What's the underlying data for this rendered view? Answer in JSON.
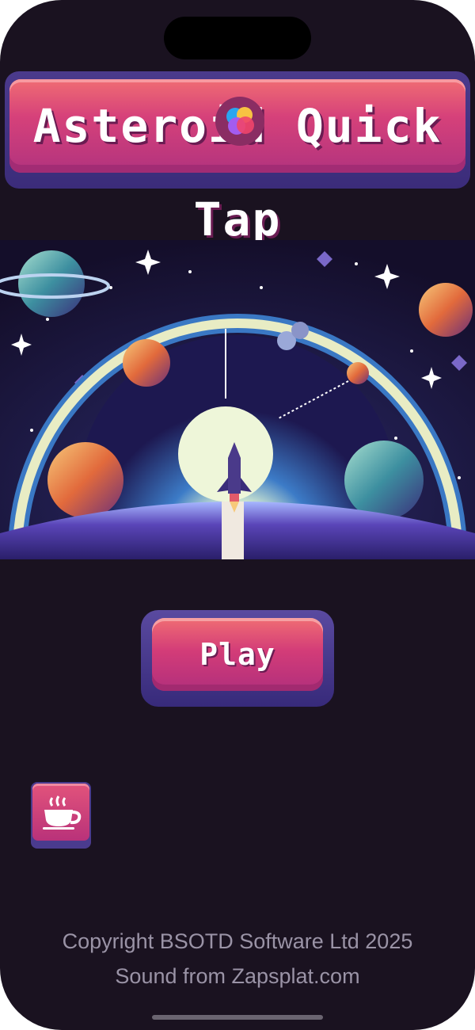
{
  "app": {
    "title": "Asteroid Quick Tap",
    "accent": "#d6417a",
    "background": "#1a1220"
  },
  "game_center": {
    "icon": "game-center-icon"
  },
  "artwork": {
    "subject": "pixel-art rocket launching from planet surface inside a space portal"
  },
  "play_button": {
    "label": "Play"
  },
  "coffee_button": {
    "icon": "coffee-cup-icon"
  },
  "footer": {
    "copyright": "Copyright BSOTD Software Ltd 2025",
    "credits": "Sound from Zapsplat.com"
  }
}
